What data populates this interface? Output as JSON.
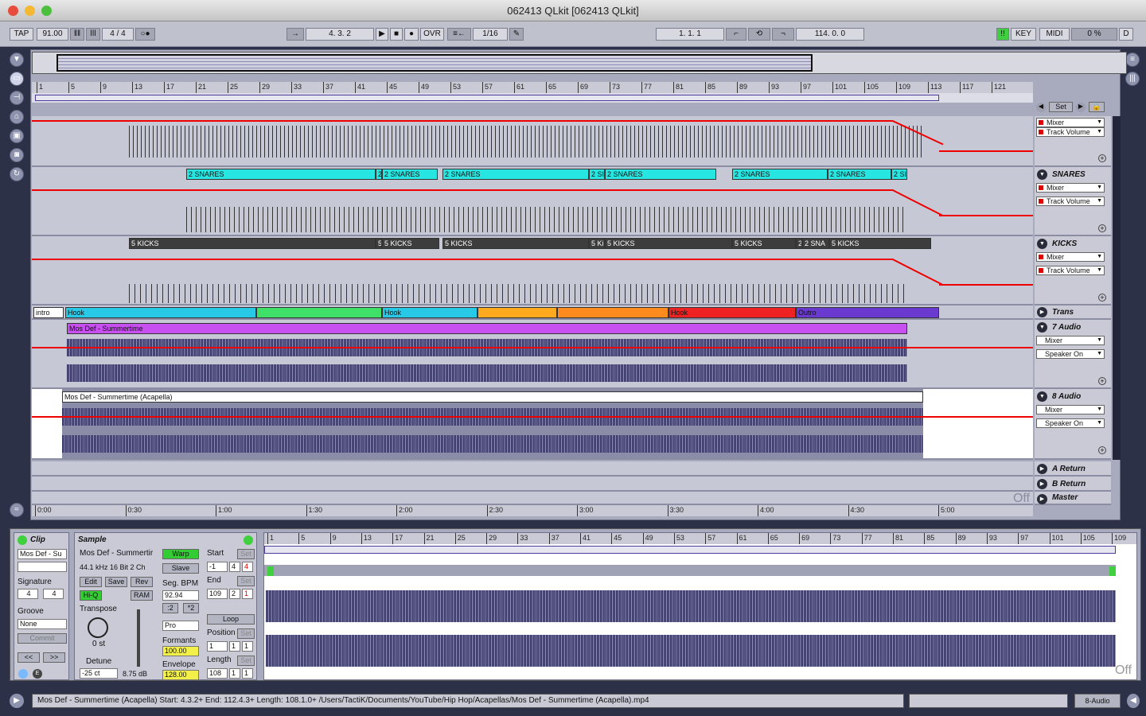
{
  "window": {
    "title": "062413 QLkit  [062413 QLkit]"
  },
  "toolbar": {
    "tap": "TAP",
    "tempo": "91.00",
    "signature": "4 / 4",
    "position": "4.   3.   2",
    "ovr": "OVR",
    "quantize": "1/16",
    "loop_start": "1.   1.   1",
    "loop_length": "114.   0.   0",
    "key": "KEY",
    "midi": "MIDI",
    "cpu": "0 %",
    "d": "D"
  },
  "ruler": {
    "bars": [
      "1",
      "5",
      "9",
      "13",
      "17",
      "21",
      "25",
      "29",
      "33",
      "37",
      "41",
      "45",
      "49",
      "53",
      "57",
      "61",
      "65",
      "69",
      "73",
      "77",
      "81",
      "85",
      "89",
      "93",
      "97",
      "101",
      "105",
      "109",
      "113",
      "117",
      "121"
    ]
  },
  "locator": {
    "set": "Set"
  },
  "tracks": {
    "hats": {
      "device": "Mixer",
      "param": "Track Volume"
    },
    "snares": {
      "name": "SNARES",
      "device": "Mixer",
      "param": "Track Volume",
      "clips": [
        "2 SNARES",
        "2",
        "2 SNARES",
        "2 SNARES",
        "2 SI",
        "2 SNARES",
        "2 SNARES",
        "2 SNARES",
        "2 SI"
      ]
    },
    "kicks": {
      "name": "KICKS",
      "device": "Mixer",
      "param": "Track Volume",
      "clips": [
        "5 KICKS",
        "5",
        "5 KICKS",
        "5 KICKS",
        "5 Ki",
        "5 KICKS",
        "5 KICKS",
        "2",
        "2 SNA",
        "5 KICKS"
      ]
    },
    "trans": {
      "name": "Trans",
      "clips": [
        "intro",
        "Hook",
        "Hook",
        "Hook",
        "Outro"
      ]
    },
    "audio7": {
      "name": "7 Audio",
      "clip": "Mos Def - Summertime",
      "device": "Mixer",
      "param": "Speaker On"
    },
    "audio8": {
      "name": "8 Audio",
      "clip": "Mos Def - Summertime (Acapella)",
      "device": "Mixer",
      "param": "Speaker On"
    },
    "returns": [
      "A Return",
      "B Return",
      "Master"
    ],
    "off": "Off"
  },
  "timeruler": [
    "0:00",
    "0:30",
    "1:00",
    "1:30",
    "2:00",
    "2:30",
    "3:00",
    "3:30",
    "4:00",
    "4:30",
    "5:00"
  ],
  "clip": {
    "title": "Clip",
    "name": "Mos Def - Su",
    "signature_label": "Signature",
    "sig_num": "4",
    "sig_den": "4",
    "groove_label": "Groove",
    "groove": "None",
    "commit": "Commit",
    "prev": "<<",
    "next": ">>"
  },
  "sample": {
    "title": "Sample",
    "name": "Mos Def - Summertir",
    "info": "44.1 kHz 16 Bit 2 Ch",
    "edit": "Edit",
    "save": "Save",
    "rev": "Rev",
    "hiq": "Hi-Q",
    "ram": "RAM",
    "transpose": "Transpose",
    "transpose_val": "0 st",
    "detune": "Detune",
    "detune_val": "-25 ct",
    "gain": "8.75 dB",
    "warp": "Warp",
    "slave": "Slave",
    "segbpm_label": "Seg. BPM",
    "segbpm": "92.94",
    "half": ":2",
    "double": "*2",
    "mode": "Pro",
    "formants_label": "Formants",
    "formants": "100.00",
    "envelope_label": "Envelope",
    "envelope": "128.00",
    "start_label": "Start",
    "start": [
      "-1",
      "4",
      "4"
    ],
    "end_label": "End",
    "end": [
      "109",
      "2",
      "1"
    ],
    "loop": "Loop",
    "position_label": "Position",
    "position": [
      "1",
      "1",
      "1"
    ],
    "length_label": "Length",
    "length": [
      "108",
      "1",
      "1"
    ],
    "set": "Set"
  },
  "sampleruler": [
    "1",
    "5",
    "9",
    "13",
    "17",
    "21",
    "25",
    "29",
    "33",
    "37",
    "41",
    "45",
    "49",
    "53",
    "57",
    "61",
    "65",
    "69",
    "73",
    "77",
    "81",
    "85",
    "89",
    "93",
    "97",
    "101",
    "105",
    "109"
  ],
  "sample_off": "Off",
  "status": {
    "text": "Mos Def - Summertime (Acapella)  Start: 4.3.2+  End: 112.4.3+  Length: 108.1.0+  /Users/TactiK/Documents/YouTube/Hip Hop/Acapellas/Mos Def - Summertime (Acapella).mp4",
    "track": "8-Audio"
  }
}
